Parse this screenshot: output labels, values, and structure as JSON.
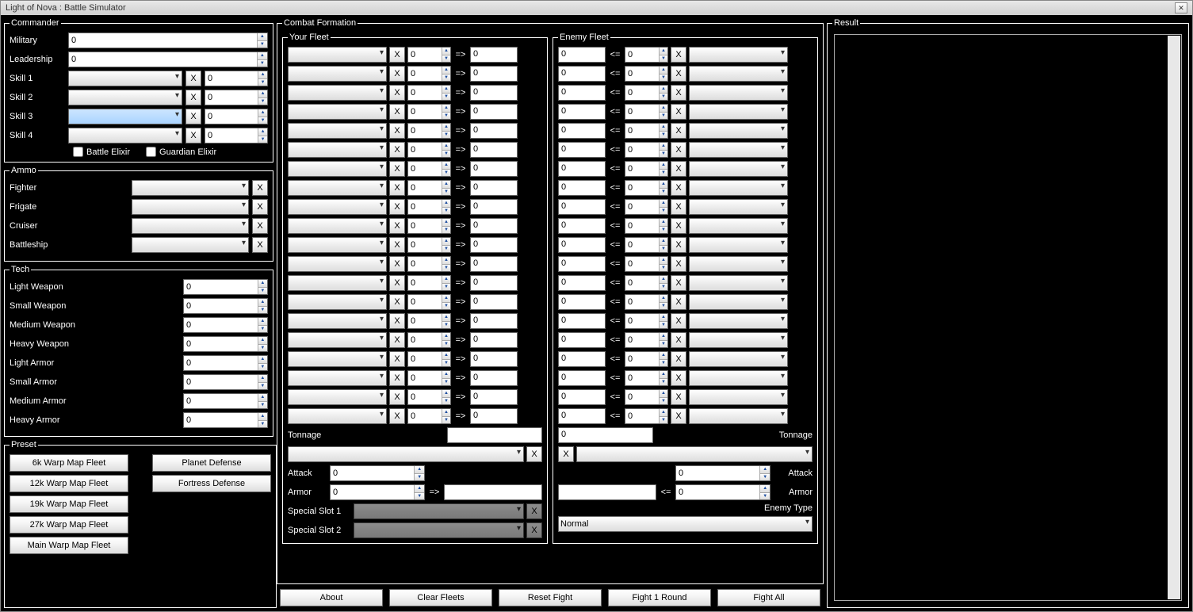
{
  "window": {
    "title": "Light of Nova : Battle Simulator"
  },
  "commander": {
    "legend": "Commander",
    "military_label": "Military",
    "military_value": "0",
    "leadership_label": "Leadership",
    "leadership_value": "0",
    "skills": [
      {
        "label": "Skill 1",
        "value": "0",
        "active": false
      },
      {
        "label": "Skill 2",
        "value": "0",
        "active": false
      },
      {
        "label": "Skill 3",
        "value": "0",
        "active": true
      },
      {
        "label": "Skill 4",
        "value": "0",
        "active": false
      }
    ],
    "battle_elixir_label": "Battle Elixir",
    "guardian_elixir_label": "Guardian Elixir",
    "x_label": "X"
  },
  "ammo": {
    "legend": "Ammo",
    "rows": [
      {
        "label": "Fighter"
      },
      {
        "label": "Frigate"
      },
      {
        "label": "Cruiser"
      },
      {
        "label": "Battleship"
      }
    ],
    "x_label": "X"
  },
  "tech": {
    "legend": "Tech",
    "rows": [
      {
        "label": "Light Weapon",
        "value": "0"
      },
      {
        "label": "Small Weapon",
        "value": "0"
      },
      {
        "label": "Medium Weapon",
        "value": "0"
      },
      {
        "label": "Heavy Weapon",
        "value": "0"
      },
      {
        "label": "Light Armor",
        "value": "0"
      },
      {
        "label": "Small Armor",
        "value": "0"
      },
      {
        "label": "Medium Armor",
        "value": "0"
      },
      {
        "label": "Heavy Armor",
        "value": "0"
      }
    ]
  },
  "preset": {
    "legend": "Preset",
    "col1": [
      "6k Warp Map Fleet",
      "12k Warp Map Fleet",
      "19k Warp Map Fleet",
      "27k Warp Map Fleet",
      "Main Warp Map Fleet"
    ],
    "col2": [
      "Planet Defense",
      "Fortress Defense"
    ]
  },
  "combat": {
    "legend": "Combat Formation",
    "your_fleet_legend": "Your Fleet",
    "enemy_fleet_legend": "Enemy Fleet",
    "x_label": "X",
    "arrow_right": "=>",
    "arrow_left": "<=",
    "count_default": "0",
    "result_default": "0",
    "rows": 20,
    "tonnage_label": "Tonnage",
    "tonnage_value": "",
    "enemy_tonnage_value": "0",
    "attack_label": "Attack",
    "attack_value": "0",
    "armor_label": "Armor",
    "armor_value": "0",
    "special1_label": "Special Slot 1",
    "special2_label": "Special Slot 2",
    "enemy_type_label": "Enemy Type",
    "enemy_type_value": "Normal",
    "enemy_attack_value": "0",
    "enemy_armor_value": "0"
  },
  "actions": {
    "about": "About",
    "clear": "Clear Fleets",
    "reset": "Reset Fight",
    "fight1": "Fight 1 Round",
    "fightall": "Fight All"
  },
  "result": {
    "legend": "Result"
  }
}
